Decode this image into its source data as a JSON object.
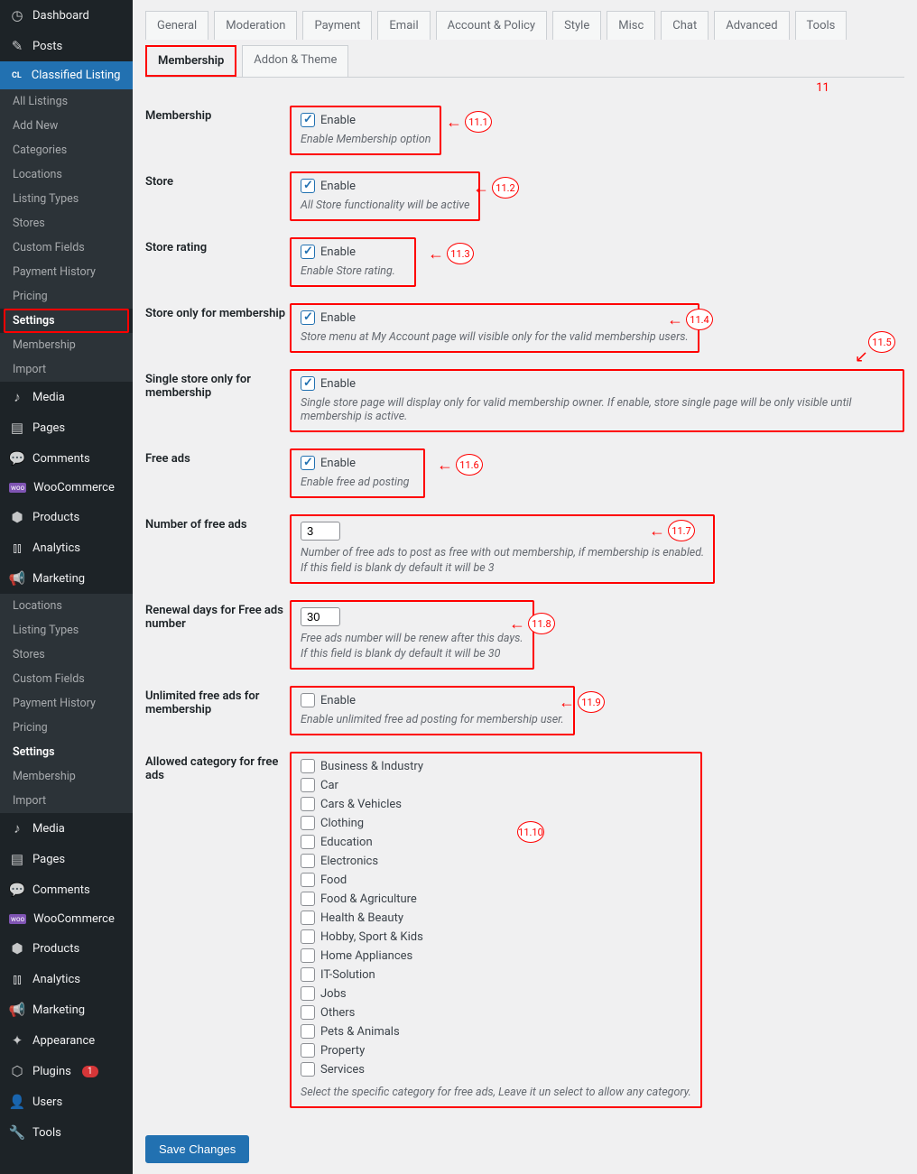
{
  "sidebar": {
    "top": [
      {
        "icon": "◷",
        "label": "Dashboard",
        "name": "dashboard"
      },
      {
        "icon": "✎",
        "label": "Posts",
        "name": "posts"
      }
    ],
    "classified_label": "Classified Listing",
    "classified_sub": [
      {
        "label": "All Listings",
        "name": "all-listings"
      },
      {
        "label": "Add New",
        "name": "add-new"
      },
      {
        "label": "Categories",
        "name": "categories"
      },
      {
        "label": "Locations",
        "name": "locations"
      },
      {
        "label": "Listing Types",
        "name": "listing-types"
      },
      {
        "label": "Stores",
        "name": "stores"
      },
      {
        "label": "Custom Fields",
        "name": "custom-fields"
      },
      {
        "label": "Payment History",
        "name": "payment-history"
      },
      {
        "label": "Pricing",
        "name": "pricing"
      },
      {
        "label": "Settings",
        "name": "settings",
        "boxed": true
      },
      {
        "label": "Membership",
        "name": "membership"
      },
      {
        "label": "Import",
        "name": "import"
      }
    ],
    "rest": [
      {
        "icon": "♪",
        "label": "Media",
        "name": "media"
      },
      {
        "icon": "▤",
        "label": "Pages",
        "name": "pages"
      },
      {
        "icon": "💬",
        "label": "Comments",
        "name": "comments"
      },
      {
        "icon": "woo",
        "label": "WooCommerce",
        "name": "woocommerce",
        "woo": true
      },
      {
        "icon": "⬢",
        "label": "Products",
        "name": "products"
      },
      {
        "icon": "⫾⫾",
        "label": "Analytics",
        "name": "analytics"
      },
      {
        "icon": "📢",
        "label": "Marketing",
        "name": "marketing"
      }
    ],
    "dup_sub": [
      {
        "label": "Locations"
      },
      {
        "label": "Listing Types"
      },
      {
        "label": "Stores"
      },
      {
        "label": "Custom Fields"
      },
      {
        "label": "Payment History"
      },
      {
        "label": "Pricing"
      },
      {
        "label": "Settings",
        "selected": true
      },
      {
        "label": "Membership"
      },
      {
        "label": "Import"
      }
    ],
    "tail": [
      {
        "icon": "♪",
        "label": "Media"
      },
      {
        "icon": "▤",
        "label": "Pages"
      },
      {
        "icon": "💬",
        "label": "Comments"
      },
      {
        "icon": "woo",
        "label": "WooCommerce",
        "woo": true
      },
      {
        "icon": "⬢",
        "label": "Products"
      },
      {
        "icon": "⫾⫾",
        "label": "Analytics"
      },
      {
        "icon": "📢",
        "label": "Marketing"
      },
      {
        "icon": "✦",
        "label": "Appearance"
      },
      {
        "icon": "⬡",
        "label": "Plugins",
        "badge": "1"
      },
      {
        "icon": "👤",
        "label": "Users"
      },
      {
        "icon": "🔧",
        "label": "Tools"
      }
    ]
  },
  "tabs": [
    {
      "label": "General"
    },
    {
      "label": "Moderation"
    },
    {
      "label": "Payment"
    },
    {
      "label": "Email"
    },
    {
      "label": "Account & Policy"
    },
    {
      "label": "Style"
    },
    {
      "label": "Misc"
    },
    {
      "label": "Chat"
    },
    {
      "label": "Advanced"
    },
    {
      "label": "Tools"
    },
    {
      "label": "Membership",
      "active": true
    },
    {
      "label": "Addon & Theme"
    }
  ],
  "anno_tabs": "11",
  "rows": {
    "membership": {
      "label": "Membership",
      "check": "Enable",
      "checked": true,
      "desc": "Enable Membership option",
      "anno": "11.1"
    },
    "store": {
      "label": "Store",
      "check": "Enable",
      "checked": true,
      "desc": "All Store functionality will be active",
      "anno": "11.2"
    },
    "rating": {
      "label": "Store rating",
      "check": "Enable",
      "checked": true,
      "desc": "Enable Store rating.",
      "anno": "11.3"
    },
    "storeonly": {
      "label": "Store only for membership",
      "check": "Enable",
      "checked": true,
      "desc": "Store menu at My Account page will visible only for the valid membership users.",
      "anno": "11.4"
    },
    "single": {
      "label": "Single store only for membership",
      "check": "Enable",
      "checked": true,
      "desc": "Single store page will display only for valid membership owner. If enable, store single page will be only visible until membership is active.",
      "anno": "11.5"
    },
    "free": {
      "label": "Free ads",
      "check": "Enable",
      "checked": true,
      "desc": "Enable free ad posting",
      "anno": "11.6"
    },
    "num": {
      "label": "Number of free ads",
      "value": "3",
      "desc": "Number of free ads to post as free with out membership, if membership is enabled.",
      "desc2": "If this field is blank dy default it will be 3",
      "anno": "11.7"
    },
    "renewal": {
      "label": "Renewal days for Free ads number",
      "value": "30",
      "desc": "Free ads number will be renew after this days.",
      "desc2": "If this field is blank dy default it will be 30",
      "anno": "11.8"
    },
    "unlimited": {
      "label": "Unlimited free ads for membership",
      "check": "Enable",
      "checked": false,
      "desc": "Enable unlimited free ad posting for membership user.",
      "anno": "11.9"
    },
    "allowed": {
      "label": "Allowed category for free ads",
      "desc": "Select the specific category for free ads, Leave it un select to allow any category.",
      "anno": "11.10",
      "cats": [
        "Business & Industry",
        "Car",
        "Cars & Vehicles",
        "Clothing",
        "Education",
        "Electronics",
        "Food",
        "Food & Agriculture",
        "Health & Beauty",
        "Hobby, Sport & Kids",
        "Home Appliances",
        "IT-Solution",
        "Jobs",
        "Others",
        "Pets & Animals",
        "Property",
        "Services"
      ]
    }
  },
  "save": "Save Changes"
}
